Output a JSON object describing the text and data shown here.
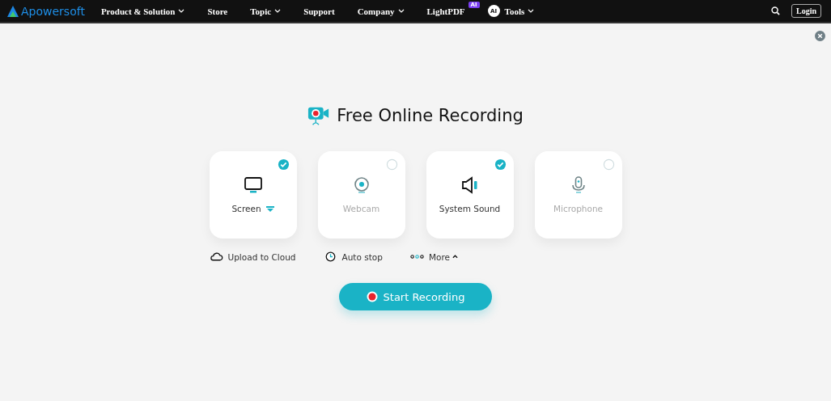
{
  "nav": {
    "logo": "Apowersoft",
    "items": [
      {
        "label": "Product & Solution",
        "menu": true
      },
      {
        "label": "Store",
        "menu": false
      },
      {
        "label": "Topic",
        "menu": true
      },
      {
        "label": "Support",
        "menu": false
      },
      {
        "label": "Company",
        "menu": true
      },
      {
        "label": "LightPDF",
        "menu": false,
        "badge": "AI"
      },
      {
        "label": "Tools",
        "menu": true,
        "ai_icon": "AI"
      }
    ],
    "login": "Login"
  },
  "title": "Free Online Recording",
  "sources": [
    {
      "kind": "screen",
      "label": "Screen",
      "selected": true,
      "menu": true
    },
    {
      "kind": "webcam",
      "label": "Webcam",
      "selected": false,
      "menu": false
    },
    {
      "kind": "sound",
      "label": "System Sound",
      "selected": true,
      "menu": false
    },
    {
      "kind": "mic",
      "label": "Microphone",
      "selected": false,
      "menu": false
    }
  ],
  "options": [
    {
      "kind": "cloud",
      "label": "Upload to Cloud"
    },
    {
      "kind": "clock",
      "label": "Auto stop"
    },
    {
      "kind": "more",
      "label": "More"
    }
  ],
  "start_button": "Start Recording"
}
